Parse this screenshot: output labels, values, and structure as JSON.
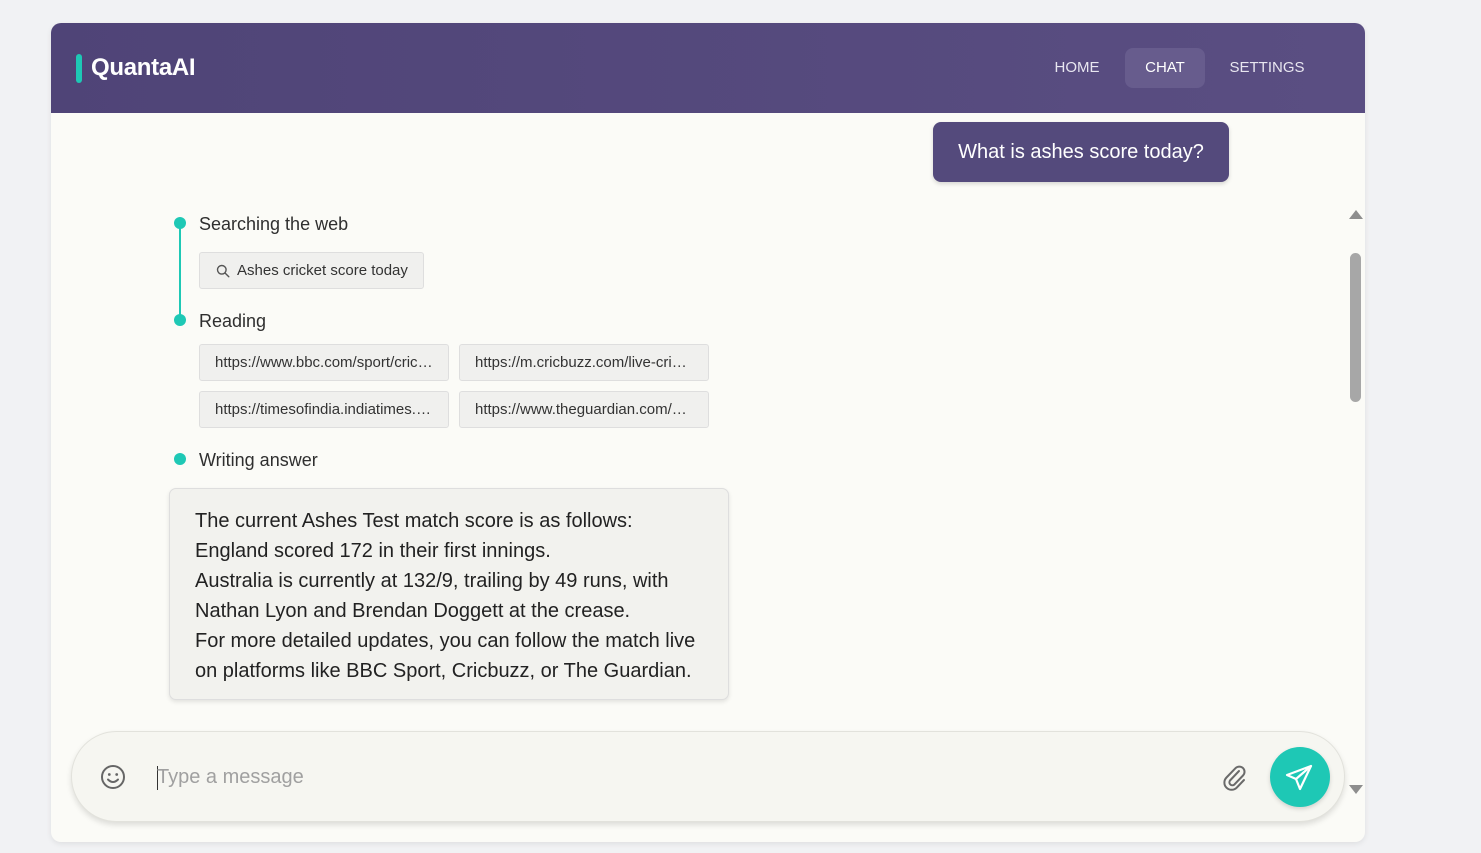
{
  "app": {
    "name": "QuantaAI"
  },
  "nav": {
    "home": "HOME",
    "chat": "CHAT",
    "settings": "SETTINGS",
    "active": "CHAT"
  },
  "chat": {
    "user_message": "What is ashes score today?",
    "steps": {
      "searching_label": "Searching the web",
      "search_query": "Ashes cricket score today",
      "reading_label": "Reading",
      "sources": [
        "https://www.bbc.com/sport/cricket",
        "https://m.cricbuzz.com/live-cricket-scores",
        "https://timesofindia.indiatimes.com",
        "https://www.theguardian.com/sport/ashes"
      ],
      "writing_label": "Writing answer"
    },
    "answer_lines": [
      "The current Ashes Test match score is as follows:",
      "England scored 172 in their first innings.",
      "Australia is currently at 132/9, trailing by 49 runs, with Nathan Lyon and Brendan Doggett at the crease.",
      "For more detailed updates, you can follow the match live on platforms like BBC Sport, Cricbuzz, or The Guardian."
    ]
  },
  "composer": {
    "placeholder": "Type a message",
    "value": ""
  },
  "icons": {
    "emoji": "smiley-icon",
    "attach": "paperclip-icon",
    "send": "paper-plane-icon",
    "search": "search-icon"
  },
  "colors": {
    "header": "#4f4477",
    "accent": "#1ec8b5",
    "user_bubble": "#544a7c",
    "nav_active": "#675c8d"
  }
}
